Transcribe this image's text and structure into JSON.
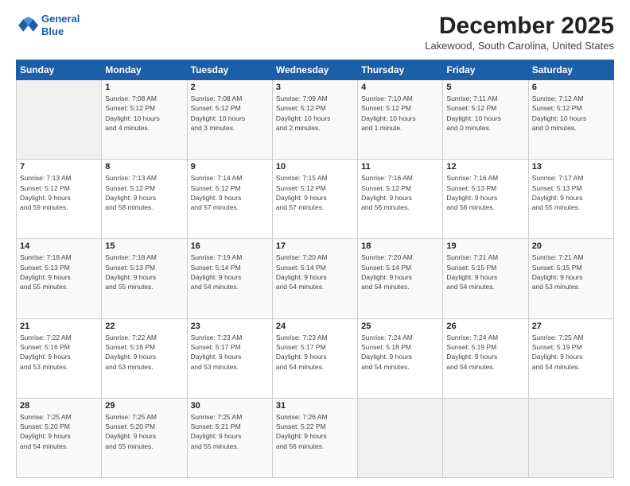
{
  "header": {
    "logo_line1": "General",
    "logo_line2": "Blue",
    "month": "December 2025",
    "location": "Lakewood, South Carolina, United States"
  },
  "days_of_week": [
    "Sunday",
    "Monday",
    "Tuesday",
    "Wednesday",
    "Thursday",
    "Friday",
    "Saturday"
  ],
  "weeks": [
    [
      {
        "num": "",
        "info": ""
      },
      {
        "num": "1",
        "info": "Sunrise: 7:08 AM\nSunset: 5:12 PM\nDaylight: 10 hours\nand 4 minutes."
      },
      {
        "num": "2",
        "info": "Sunrise: 7:08 AM\nSunset: 5:12 PM\nDaylight: 10 hours\nand 3 minutes."
      },
      {
        "num": "3",
        "info": "Sunrise: 7:09 AM\nSunset: 5:12 PM\nDaylight: 10 hours\nand 2 minutes."
      },
      {
        "num": "4",
        "info": "Sunrise: 7:10 AM\nSunset: 5:12 PM\nDaylight: 10 hours\nand 1 minute."
      },
      {
        "num": "5",
        "info": "Sunrise: 7:11 AM\nSunset: 5:12 PM\nDaylight: 10 hours\nand 0 minutes."
      },
      {
        "num": "6",
        "info": "Sunrise: 7:12 AM\nSunset: 5:12 PM\nDaylight: 10 hours\nand 0 minutes."
      }
    ],
    [
      {
        "num": "7",
        "info": "Sunrise: 7:13 AM\nSunset: 5:12 PM\nDaylight: 9 hours\nand 59 minutes."
      },
      {
        "num": "8",
        "info": "Sunrise: 7:13 AM\nSunset: 5:12 PM\nDaylight: 9 hours\nand 58 minutes."
      },
      {
        "num": "9",
        "info": "Sunrise: 7:14 AM\nSunset: 5:12 PM\nDaylight: 9 hours\nand 57 minutes."
      },
      {
        "num": "10",
        "info": "Sunrise: 7:15 AM\nSunset: 5:12 PM\nDaylight: 9 hours\nand 57 minutes."
      },
      {
        "num": "11",
        "info": "Sunrise: 7:16 AM\nSunset: 5:12 PM\nDaylight: 9 hours\nand 56 minutes."
      },
      {
        "num": "12",
        "info": "Sunrise: 7:16 AM\nSunset: 5:13 PM\nDaylight: 9 hours\nand 56 minutes."
      },
      {
        "num": "13",
        "info": "Sunrise: 7:17 AM\nSunset: 5:13 PM\nDaylight: 9 hours\nand 55 minutes."
      }
    ],
    [
      {
        "num": "14",
        "info": "Sunrise: 7:18 AM\nSunset: 5:13 PM\nDaylight: 9 hours\nand 55 minutes."
      },
      {
        "num": "15",
        "info": "Sunrise: 7:18 AM\nSunset: 5:13 PM\nDaylight: 9 hours\nand 55 minutes."
      },
      {
        "num": "16",
        "info": "Sunrise: 7:19 AM\nSunset: 5:14 PM\nDaylight: 9 hours\nand 54 minutes."
      },
      {
        "num": "17",
        "info": "Sunrise: 7:20 AM\nSunset: 5:14 PM\nDaylight: 9 hours\nand 54 minutes."
      },
      {
        "num": "18",
        "info": "Sunrise: 7:20 AM\nSunset: 5:14 PM\nDaylight: 9 hours\nand 54 minutes."
      },
      {
        "num": "19",
        "info": "Sunrise: 7:21 AM\nSunset: 5:15 PM\nDaylight: 9 hours\nand 54 minutes."
      },
      {
        "num": "20",
        "info": "Sunrise: 7:21 AM\nSunset: 5:15 PM\nDaylight: 9 hours\nand 53 minutes."
      }
    ],
    [
      {
        "num": "21",
        "info": "Sunrise: 7:22 AM\nSunset: 5:16 PM\nDaylight: 9 hours\nand 53 minutes."
      },
      {
        "num": "22",
        "info": "Sunrise: 7:22 AM\nSunset: 5:16 PM\nDaylight: 9 hours\nand 53 minutes."
      },
      {
        "num": "23",
        "info": "Sunrise: 7:23 AM\nSunset: 5:17 PM\nDaylight: 9 hours\nand 53 minutes."
      },
      {
        "num": "24",
        "info": "Sunrise: 7:23 AM\nSunset: 5:17 PM\nDaylight: 9 hours\nand 54 minutes."
      },
      {
        "num": "25",
        "info": "Sunrise: 7:24 AM\nSunset: 5:18 PM\nDaylight: 9 hours\nand 54 minutes."
      },
      {
        "num": "26",
        "info": "Sunrise: 7:24 AM\nSunset: 5:19 PM\nDaylight: 9 hours\nand 54 minutes."
      },
      {
        "num": "27",
        "info": "Sunrise: 7:25 AM\nSunset: 5:19 PM\nDaylight: 9 hours\nand 54 minutes."
      }
    ],
    [
      {
        "num": "28",
        "info": "Sunrise: 7:25 AM\nSunset: 5:20 PM\nDaylight: 9 hours\nand 54 minutes."
      },
      {
        "num": "29",
        "info": "Sunrise: 7:25 AM\nSunset: 5:20 PM\nDaylight: 9 hours\nand 55 minutes."
      },
      {
        "num": "30",
        "info": "Sunrise: 7:25 AM\nSunset: 5:21 PM\nDaylight: 9 hours\nand 55 minutes."
      },
      {
        "num": "31",
        "info": "Sunrise: 7:26 AM\nSunset: 5:22 PM\nDaylight: 9 hours\nand 56 minutes."
      },
      {
        "num": "",
        "info": ""
      },
      {
        "num": "",
        "info": ""
      },
      {
        "num": "",
        "info": ""
      }
    ]
  ]
}
